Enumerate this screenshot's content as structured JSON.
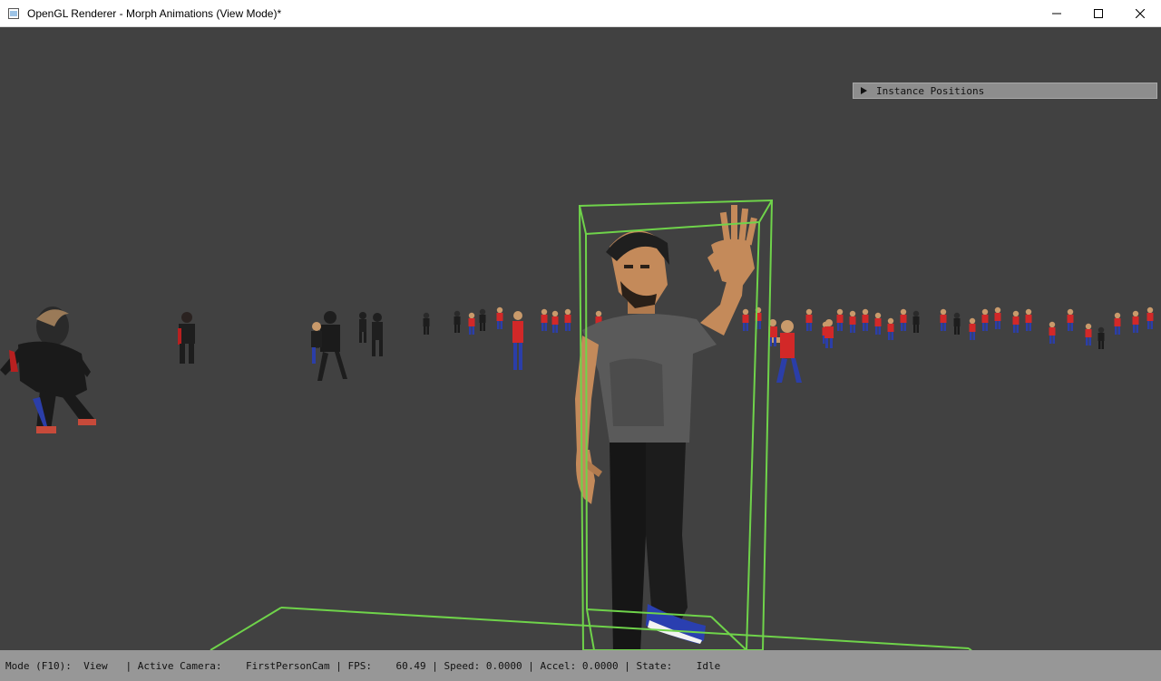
{
  "window": {
    "title": "OpenGL Renderer - Morph Animations (View Mode)*",
    "icon": "app-window-icon",
    "controls": [
      "minimize-icon",
      "maximize-icon",
      "close-icon"
    ]
  },
  "overlay": {
    "instance_panel_label": "Instance Positions",
    "instance_panel_icon": "collapsed-triangle-icon"
  },
  "status": {
    "mode_label": "Mode (F10):",
    "mode_value": "View",
    "camera_label": "Active Camera:",
    "camera_value": "FirstPersonCam",
    "fps_label": "FPS:",
    "fps_value": "60.49",
    "speed_label": "Speed:",
    "speed_value": "0.0000",
    "accel_label": "Accel:",
    "accel_value": "0.0000",
    "state_label": "State:",
    "state_value": "Idle",
    "separator": "|"
  },
  "colors": {
    "background": "#414141",
    "bounding_box": "#6fd34a",
    "statusbar": "#9e9e9e"
  }
}
